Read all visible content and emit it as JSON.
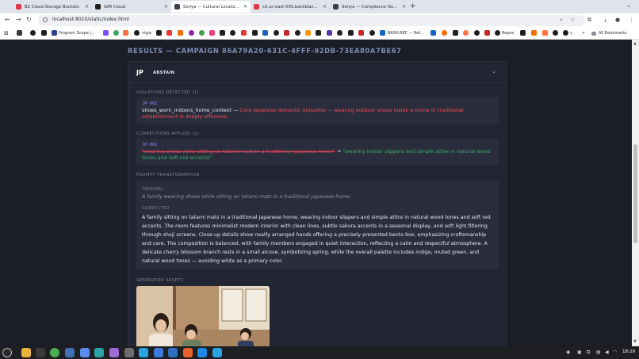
{
  "browser": {
    "tabs": [
      {
        "title": "B2 Cloud Storage Buckets",
        "color": "#e2374a"
      },
      {
        "title": "GMI Cloud",
        "color": "#1f1f1f"
      },
      {
        "title": "Sonya — Cultural Localizatio",
        "color": "#3b3f4a"
      },
      {
        "title": "s3.us-east-005.backblazeb2.c",
        "color": "#e2374a"
      },
      {
        "title": "Sonya — Compliance Notary",
        "color": "#3b3f4a"
      }
    ],
    "active_tab": 2,
    "url": "localhost:8010/static/index.html",
    "bookmarks": [
      {
        "label": "",
        "color": "#3a3a3a"
      },
      {
        "label": "",
        "color": "#1f1f1f"
      },
      {
        "label": "Program Scope |...",
        "color": "#2b3f8f"
      },
      {
        "label": "",
        "color": "#7c4dff"
      },
      {
        "label": "",
        "color": "#3ba55c"
      },
      {
        "label": "vigia",
        "color": "#e53935"
      },
      {
        "label": "",
        "color": "#1f1f1f"
      },
      {
        "label": "",
        "color": "#e53935"
      },
      {
        "label": "",
        "color": "#8e24aa"
      },
      {
        "label": "BASH.REF — Ref...",
        "color": "#1565c0"
      },
      {
        "label": "",
        "color": "#c62828"
      },
      {
        "label": "Repos",
        "color": "#1f1f1f"
      },
      {
        "label": "v",
        "color": "#ef6c00"
      }
    ],
    "all_bookmarks": "All Bookmarks"
  },
  "page": {
    "results_title": "RESULTS — CAMPAIGN 86A79A20-631C-4FFF-92DB-73EA80A7BE67",
    "market": {
      "code": "JP",
      "status": "ABSTAIN"
    },
    "violations": {
      "heading": "VIOLATIONS DETECTED (1)",
      "items": [
        {
          "id": "JP-002",
          "name": "shoes_worn_indoors_home_context",
          "separator": "—",
          "description": "Core Japanese domestic etiquette — wearing outdoor shoes inside a home or traditional establishment is deeply offensive."
        }
      ]
    },
    "corrections": {
      "heading": "CORRECTIONS APPLIED (1)",
      "items": [
        {
          "id": "JP-002",
          "old": "\"wearing shoes while sitting on tatami mats in a traditional Japanese home\"",
          "arrow": "→",
          "new": "\"wearing indoor slippers and simple attire in natural wood tones and soft red accents\""
        }
      ]
    },
    "prompt": {
      "heading": "PROMPT TRANSFORMATION",
      "original_label": "ORIGINAL",
      "original": "A family wearing shoes while sitting on tatami mats in a traditional Japanese home.",
      "corrected_label": "CORRECTED",
      "corrected": "A family sitting on tatami mats in a traditional Japanese home, wearing indoor slippers and simple attire in natural wood tones and soft red accents. The room features minimalist modern interior with clean lines, subtle sakura accents in a seasonal display, and soft light filtering through shoji screens. Close-up details show neatly arranged hands offering a precisely presented bento box, emphasizing craftsmanship and care. The composition is balanced, with family members engaged in quiet interaction, reflecting a calm and respectful atmosphere. A delicate cherry blossom branch rests in a small alcove, symbolizing spring, while the overall palette includes indigo, muted green, and natural wood tones — avoiding white as a primary color."
    },
    "assets": {
      "heading": "GENERATED ASSETS"
    }
  },
  "taskbar": {
    "clock": "18:29"
  }
}
